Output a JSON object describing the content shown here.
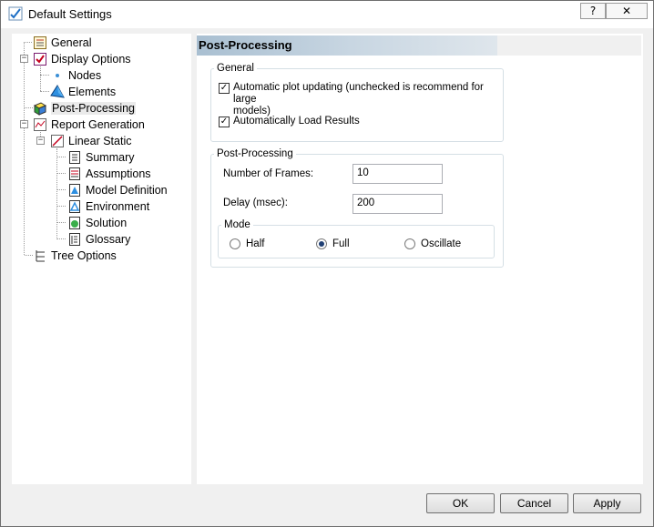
{
  "window": {
    "title": "Default Settings",
    "help_label": "?",
    "close_label": "✕"
  },
  "tree": {
    "items": [
      {
        "label": "General",
        "icon": "settings-list-icon"
      },
      {
        "label": "Display Options",
        "icon": "display-options-icon"
      },
      {
        "label": "Nodes",
        "icon": "bullet-dot-icon"
      },
      {
        "label": "Elements",
        "icon": "elements-shape-icon"
      },
      {
        "label": "Post-Processing",
        "icon": "post-processing-cube-icon"
      },
      {
        "label": "Report Generation",
        "icon": "report-icon"
      },
      {
        "label": "Linear Static",
        "icon": "linear-static-chart-icon"
      },
      {
        "label": "Summary",
        "icon": "summary-doc-icon"
      },
      {
        "label": "Assumptions",
        "icon": "assumptions-doc-icon"
      },
      {
        "label": "Model Definition",
        "icon": "model-definition-icon"
      },
      {
        "label": "Environment",
        "icon": "environment-icon"
      },
      {
        "label": "Solution",
        "icon": "solution-icon"
      },
      {
        "label": "Glossary",
        "icon": "glossary-doc-icon"
      },
      {
        "label": "Tree Options",
        "icon": "tree-options-icon"
      }
    ]
  },
  "content": {
    "header": "Post-Processing",
    "general_group": {
      "legend": "General",
      "auto_plot_label_line1": "Automatic plot updating (unchecked is recommend for large",
      "auto_plot_label_line2": "models)",
      "auto_plot_checked": true,
      "auto_load_label": "Automatically Load Results",
      "auto_load_checked": true
    },
    "pp_group": {
      "legend": "Post-Processing",
      "frames_label": "Number of Frames:",
      "frames_value": "10",
      "delay_label": "Delay (msec):",
      "delay_value": "200",
      "mode_legend": "Mode",
      "modes": [
        "Half",
        "Full",
        "Oscillate"
      ],
      "selected_mode": "Full"
    }
  },
  "buttons": {
    "ok": "OK",
    "cancel": "Cancel",
    "apply": "Apply"
  },
  "colors": {
    "header_band": "#a9bfd1",
    "window_bg": "#f0f0f0",
    "groupbox_border": "#d5dfe5"
  }
}
